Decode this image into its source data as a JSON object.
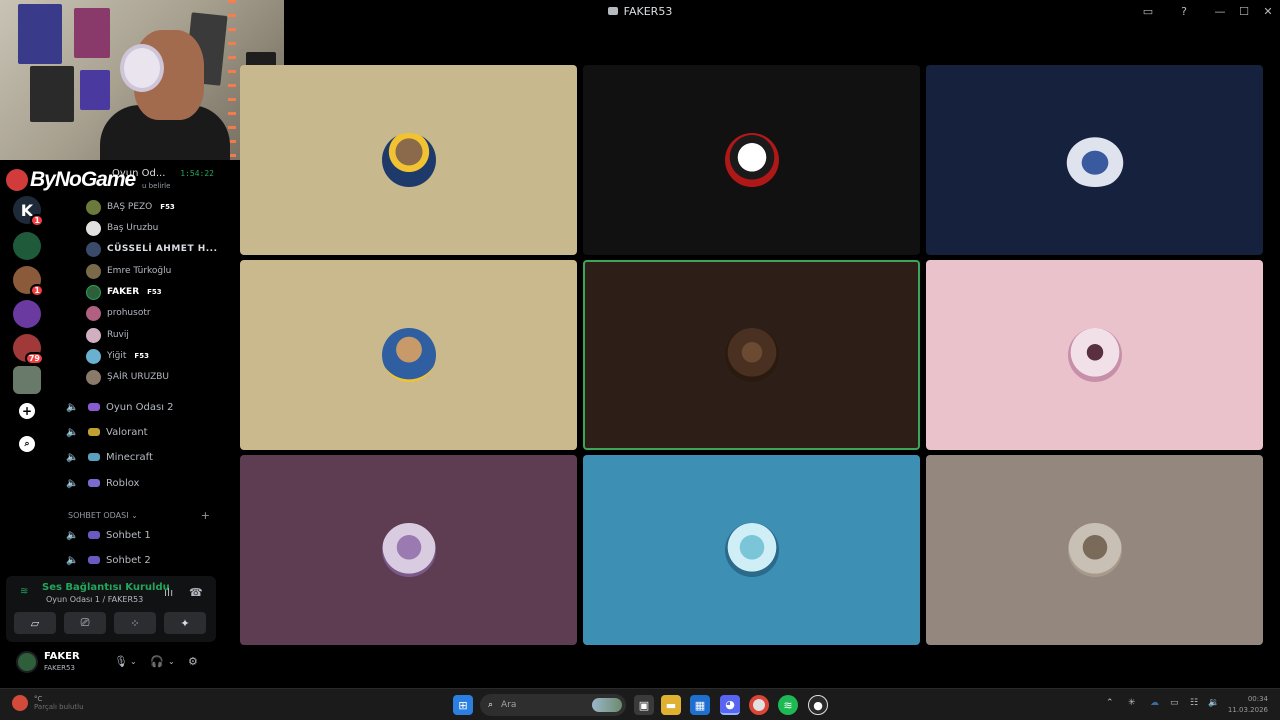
{
  "window": {
    "title": "FAKER53",
    "controls": [
      "inbox",
      "help",
      "minimize",
      "maximize",
      "close"
    ]
  },
  "stream_overlay": {
    "brand_text": "ByNoGame"
  },
  "channel_header": {
    "name": "Oyun Od...",
    "subtitle": "u belirle",
    "timer": "1:54:22"
  },
  "server_rail": {
    "badges": [
      "1",
      "1",
      "79"
    ]
  },
  "members": [
    {
      "name": "BAŞ PEZO",
      "tag": "F53",
      "color": "#6b7a3a",
      "style": ""
    },
    {
      "name": "Baş Uruzbu",
      "tag": "",
      "color": "#e0e0e0",
      "style": ""
    },
    {
      "name": "CÜSSELİ AHMET H...",
      "tag": "",
      "color": "#3a4a6b",
      "style": "bold"
    },
    {
      "name": "Emre Türkoğlu",
      "tag": "",
      "color": "#7a6a4a",
      "style": ""
    },
    {
      "name": "FAKER",
      "tag": "F53",
      "color": "#2e5e3a",
      "style": "me"
    },
    {
      "name": "prohusotr",
      "tag": "",
      "color": "#b06080",
      "style": ""
    },
    {
      "name": "Ruvij",
      "tag": "",
      "color": "#d0b0c0",
      "style": ""
    },
    {
      "name": "Yiğit",
      "tag": "F53",
      "color": "#6ab0d0",
      "style": ""
    },
    {
      "name": "ŞAİR URUZBU",
      "tag": "",
      "color": "#8a7a6a",
      "style": ""
    }
  ],
  "voice_channels": [
    {
      "label": "Oyun Odası 2",
      "color": "#8a5ad0"
    },
    {
      "label": "Valorant",
      "color": "#c0a030"
    },
    {
      "label": "Minecraft",
      "color": "#5aa0c0"
    },
    {
      "label": "Roblox",
      "color": "#7a6ad0"
    }
  ],
  "category": {
    "label": "SOHBET ODASI",
    "chevron": "⌄",
    "add": "+"
  },
  "chat_channels": [
    {
      "label": "Sohbet 1"
    },
    {
      "label": "Sohbet 2"
    }
  ],
  "voice_panel": {
    "status": "Ses Bağlantısı Kuruldu",
    "channel": "Oyun Odası 1 / FAKER53"
  },
  "user_panel": {
    "name": "FAKER",
    "status": "FAKER53"
  },
  "video_tiles": [
    {
      "name": "tile-1",
      "bg": "#c8b88e",
      "avatar": "#1d3a6a",
      "speaking": false
    },
    {
      "name": "tile-2",
      "bg": "#111111",
      "avatar": "#ffffff",
      "speaking": false
    },
    {
      "name": "tile-3",
      "bg": "#16213e",
      "avatar": "#dfe3ee",
      "speaking": false
    },
    {
      "name": "tile-4",
      "bg": "#cbb98e",
      "avatar": "#2f5fa0",
      "speaking": false
    },
    {
      "name": "tile-5",
      "bg": "#2d1f17",
      "avatar": "#4a3020",
      "speaking": true
    },
    {
      "name": "tile-6",
      "bg": "#e9c2cc",
      "avatar": "#f2e0e8",
      "speaking": false
    },
    {
      "name": "tile-7",
      "bg": "#5e3c52",
      "avatar": "#d9cce0",
      "speaking": false
    },
    {
      "name": "tile-8",
      "bg": "#3d8fb4",
      "avatar": "#cfeef5",
      "speaking": false
    },
    {
      "name": "tile-9",
      "bg": "#93877e",
      "avatar": "#c8bfb5",
      "speaking": false
    }
  ],
  "taskbar": {
    "search_placeholder": "Ara",
    "weather_line1": "°C",
    "weather_line2": "Parçalı bulutlu",
    "clock_time": "00:34",
    "clock_date": "11.03.2026"
  },
  "colors": {
    "accent_green": "#23a55a",
    "speaking_outline": "#3ba55c",
    "badge_red": "#f23f43"
  }
}
